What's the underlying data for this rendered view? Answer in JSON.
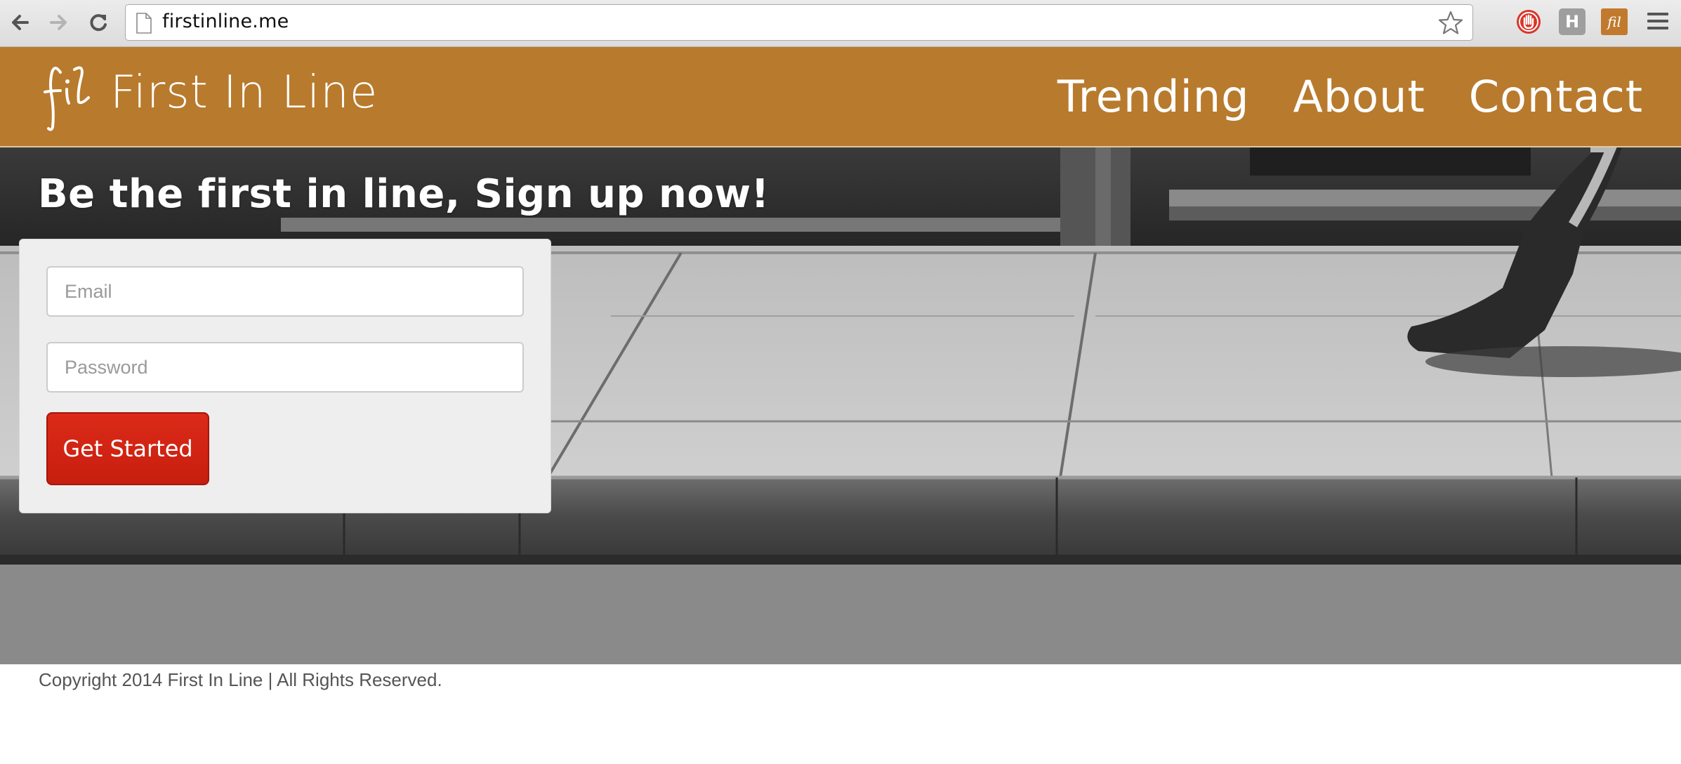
{
  "browser": {
    "url": "firstinline.me",
    "icons": [
      "back-arrow-icon",
      "forward-arrow-icon",
      "reload-icon",
      "page-icon",
      "bookmark-star-icon",
      "stop-hand-extension-icon",
      "h-extension-icon",
      "fil-extension-icon",
      "hamburger-menu-icon"
    ],
    "extensions": {
      "h_label": "H",
      "fil_label": "fil"
    }
  },
  "header": {
    "logo_text": "fil",
    "brand": "First In Line",
    "nav": [
      {
        "label": "Trending"
      },
      {
        "label": "About"
      },
      {
        "label": "Contact"
      }
    ],
    "color": "#b87a2d"
  },
  "hero": {
    "tagline": "Be the first in line, Sign up now!",
    "form": {
      "email_placeholder": "Email",
      "password_placeholder": "Password",
      "submit_label": "Get Started",
      "submit_color": "#d62616"
    }
  },
  "footer": {
    "copyright": "Copyright 2014 First In Line | All Rights Reserved."
  }
}
